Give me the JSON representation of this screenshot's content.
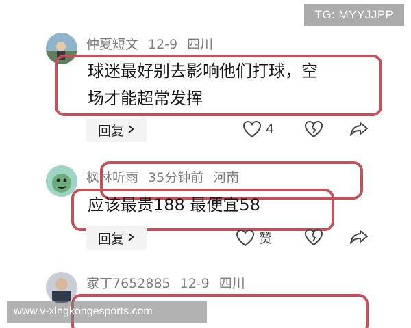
{
  "watermarks": {
    "top": "TG: MYYJJPP",
    "bottom": "www.v-xingkongesports.com"
  },
  "comments": [
    {
      "username": "仲夏短文",
      "date": "12-9",
      "location": "四川",
      "line1": "球迷最好别去影响他们打球，空",
      "line2": "场才能超常发挥",
      "reply_label": "回复",
      "like_count": "4"
    },
    {
      "username": "枫林听雨",
      "date": "35分钟前",
      "location": "河南",
      "line1": "应该最贵188 最便宜58",
      "reply_label": "回复",
      "like_label": "赞"
    },
    {
      "username": "家丁7652885",
      "date": "12-9",
      "location": "四川"
    }
  ],
  "icons": {
    "heart": "heart-icon",
    "broken_heart": "broken-heart-icon",
    "share": "share-icon",
    "chevron": "chevron-right-icon"
  },
  "colors": {
    "highlight": "#c0525b",
    "meta_text": "#7d7d7d",
    "reply_bg": "#f3f3f3"
  }
}
